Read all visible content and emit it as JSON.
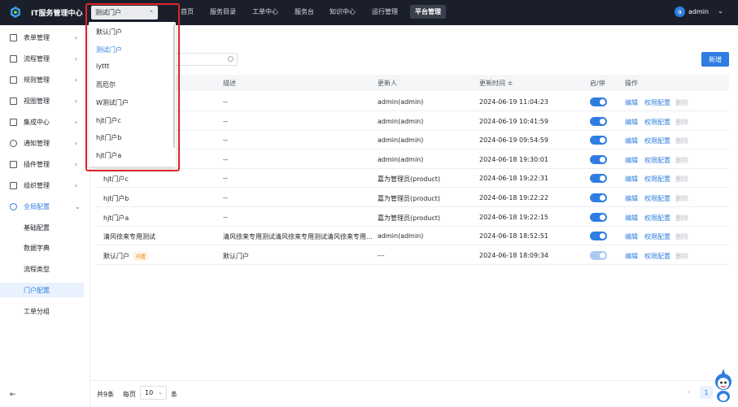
{
  "header": {
    "app_title": "IT服务管理中心",
    "portal_selected": "测试门户",
    "nav": [
      "首页",
      "服务目录",
      "工单中心",
      "服务台",
      "知识中心",
      "运行管理",
      "平台管理"
    ],
    "active_nav": "平台管理",
    "user_initial": "a",
    "user_name": "admin"
  },
  "portal_dropdown": {
    "options": [
      "默认门户",
      "测试门户",
      "lyttt",
      "而厄尔",
      "W测试门户",
      "hjt门户c",
      "hjt门户b",
      "hjt门户a"
    ],
    "selected": "测试门户"
  },
  "sidebar": {
    "items": [
      "表单管理",
      "流程管理",
      "规则管理",
      "视图管理",
      "集成中心",
      "通知管理",
      "插件管理",
      "组织管理",
      "全局配置"
    ],
    "sub_items": [
      "基础配置",
      "数据字典",
      "流程类型",
      "门户配置",
      "工单分组"
    ],
    "active_sub": "门户配置"
  },
  "toolbar": {
    "add_label": "新增"
  },
  "table": {
    "columns": [
      "描述",
      "更新人",
      "更新时间 ≑",
      "启/停",
      "操作"
    ],
    "actions": [
      "编辑",
      "权限配置",
      "删除"
    ],
    "rows": [
      {
        "name": "",
        "badge": "",
        "desc": "--",
        "updater": "admin(admin)",
        "time": "2024-06-19 11:04:23",
        "enabled": true
      },
      {
        "name": "",
        "badge": "",
        "desc": "--",
        "updater": "admin(admin)",
        "time": "2024-06-19 10:41:59",
        "enabled": true
      },
      {
        "name": "",
        "badge": "",
        "desc": "--",
        "updater": "admin(admin)",
        "time": "2024-06-19 09:54:59",
        "enabled": true
      },
      {
        "name": "",
        "badge": "",
        "desc": "--",
        "updater": "admin(admin)",
        "time": "2024-06-18 19:30:01",
        "enabled": true
      },
      {
        "name": "hjt门户c",
        "badge": "",
        "desc": "--",
        "updater": "嘉为管理员(product)",
        "time": "2024-06-18 19:22:31",
        "enabled": true
      },
      {
        "name": "hjt门户b",
        "badge": "",
        "desc": "--",
        "updater": "嘉为管理员(product)",
        "time": "2024-06-18 19:22:22",
        "enabled": true
      },
      {
        "name": "hjt门户a",
        "badge": "",
        "desc": "--",
        "updater": "嘉为管理员(product)",
        "time": "2024-06-18 19:22:15",
        "enabled": true
      },
      {
        "name": "清风徐来专用测试",
        "badge": "",
        "desc": "清风徐来专用测试清风徐来专用测试清风徐来专用...",
        "updater": "admin(admin)",
        "time": "2024-06-18 18:52:51",
        "enabled": true
      },
      {
        "name": "默认门户",
        "badge": "内置",
        "desc": "默认门户",
        "updater": "---",
        "time": "2024-06-18 18:09:34",
        "enabled": true
      }
    ]
  },
  "footer": {
    "total": "共9条",
    "per_page_label": "每页",
    "page_size": "10",
    "unit": "条",
    "current_page": "1"
  },
  "colors": {
    "accent": "#2f7de1",
    "topbar": "#1b1f2b",
    "highlight_frame": "#e0242a"
  }
}
